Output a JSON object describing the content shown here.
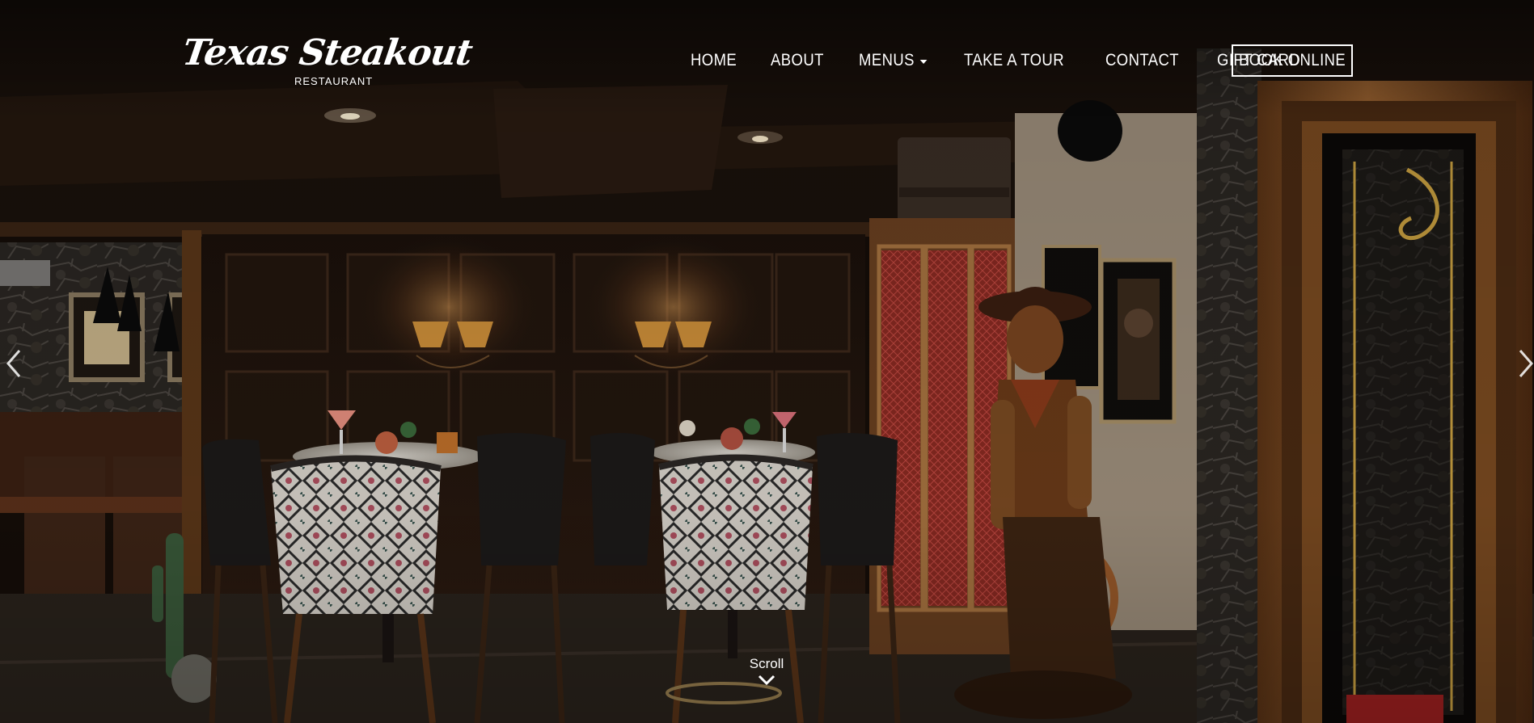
{
  "header": {
    "logo": {
      "script_text": "Texas Steakout",
      "subtitle": "RESTAURANT"
    },
    "nav": [
      {
        "label": "HOME"
      },
      {
        "label": "ABOUT"
      },
      {
        "label": "MENUS",
        "has_dropdown": true
      },
      {
        "label": "TAKE A TOUR"
      },
      {
        "label": "CONTACT"
      },
      {
        "label": "GIFT CARD"
      }
    ],
    "book_button_label": "BOOK ONLINE"
  },
  "hero": {
    "image_description_icon": "restaurant-interior-image",
    "scroll_label": "Scroll",
    "prev_icon": "chevron-left-icon",
    "next_icon": "chevron-right-icon"
  },
  "colors": {
    "text": "#ffffff",
    "wood_dark": "#2a1a10",
    "wood_warm": "#6b3f1f",
    "lamp_glow": "#e0a050",
    "cabinet_red": "#a0302a"
  }
}
